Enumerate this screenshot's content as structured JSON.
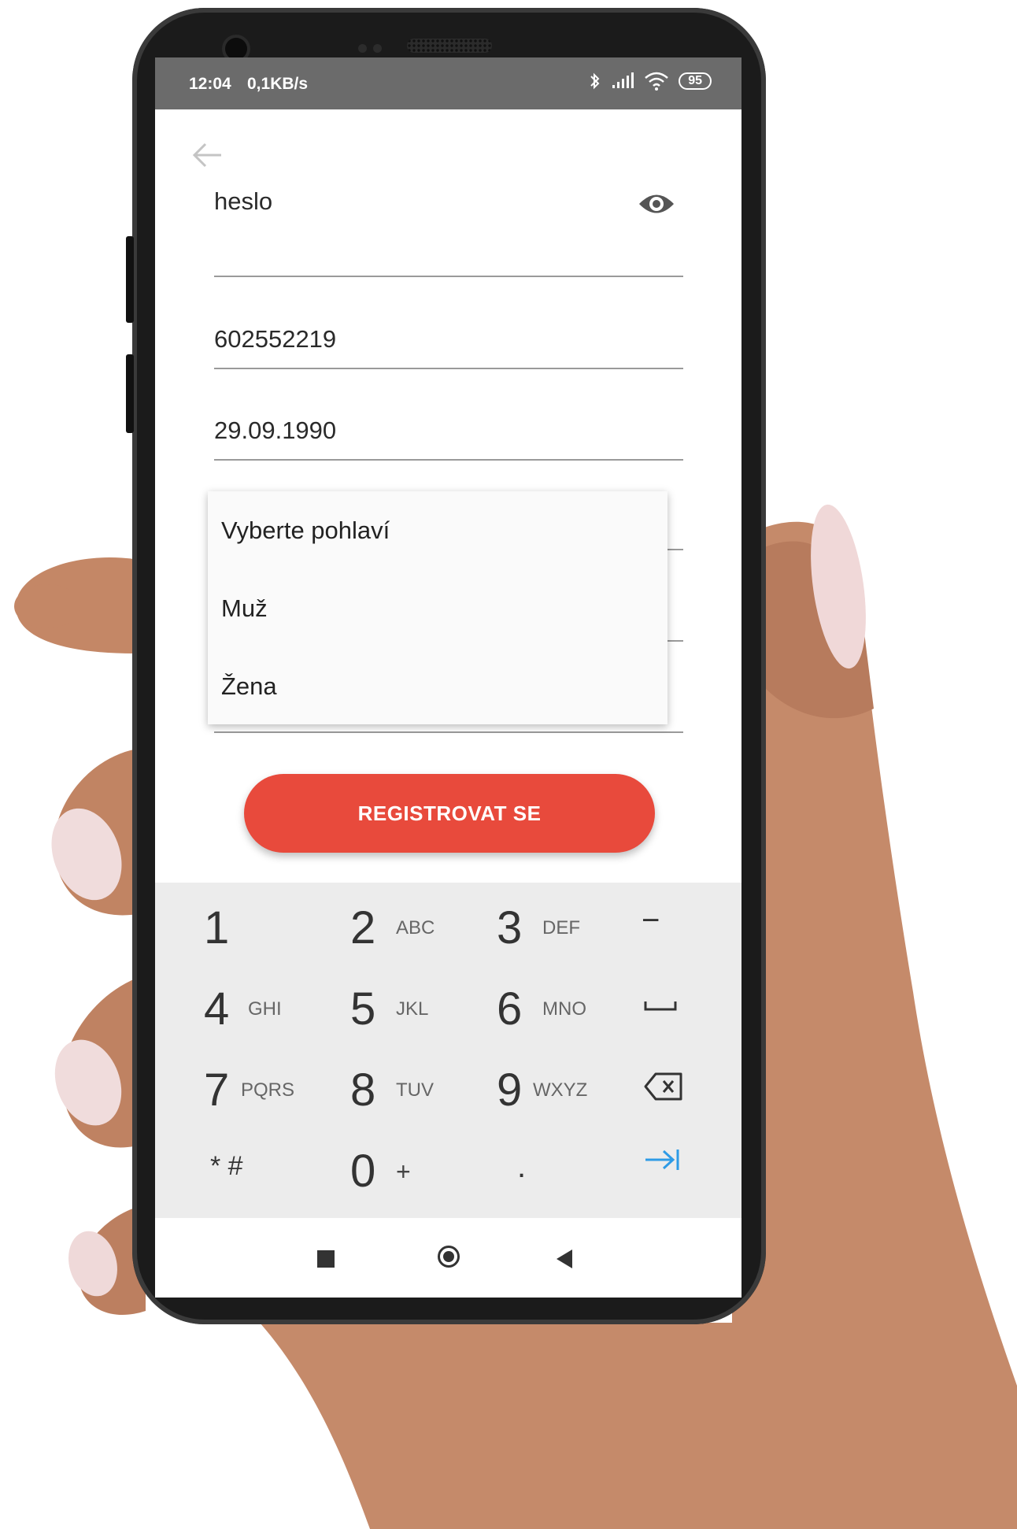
{
  "status_bar": {
    "time": "12:04",
    "speed": "0,1KB/s",
    "battery": "95",
    "icons": [
      "bluetooth-icon",
      "signal-icon",
      "wifi-icon",
      "battery-icon"
    ]
  },
  "form": {
    "password_value": "heslo",
    "phone_value": "602552219",
    "birthdate_value": "29.09.1990"
  },
  "gender_dropdown": {
    "options": [
      "Vyberte pohlaví",
      "Muž",
      "Žena"
    ]
  },
  "register_button": {
    "label": "REGISTROVAT SE",
    "color": "#e84a3c"
  },
  "keyboard": {
    "keys": [
      {
        "digit": "1",
        "letters": ""
      },
      {
        "digit": "2",
        "letters": "ABC"
      },
      {
        "digit": "3",
        "letters": "DEF"
      },
      {
        "digit": "4",
        "letters": "GHI"
      },
      {
        "digit": "5",
        "letters": "JKL"
      },
      {
        "digit": "6",
        "letters": "MNO"
      },
      {
        "digit": "7",
        "letters": "PQRS"
      },
      {
        "digit": "8",
        "letters": "TUV"
      },
      {
        "digit": "9",
        "letters": "WXYZ"
      },
      {
        "digit": "0",
        "letters": "+"
      }
    ],
    "star_hash": "* #",
    "minus": "−",
    "dot": ".",
    "accent": "#2e9be6"
  }
}
